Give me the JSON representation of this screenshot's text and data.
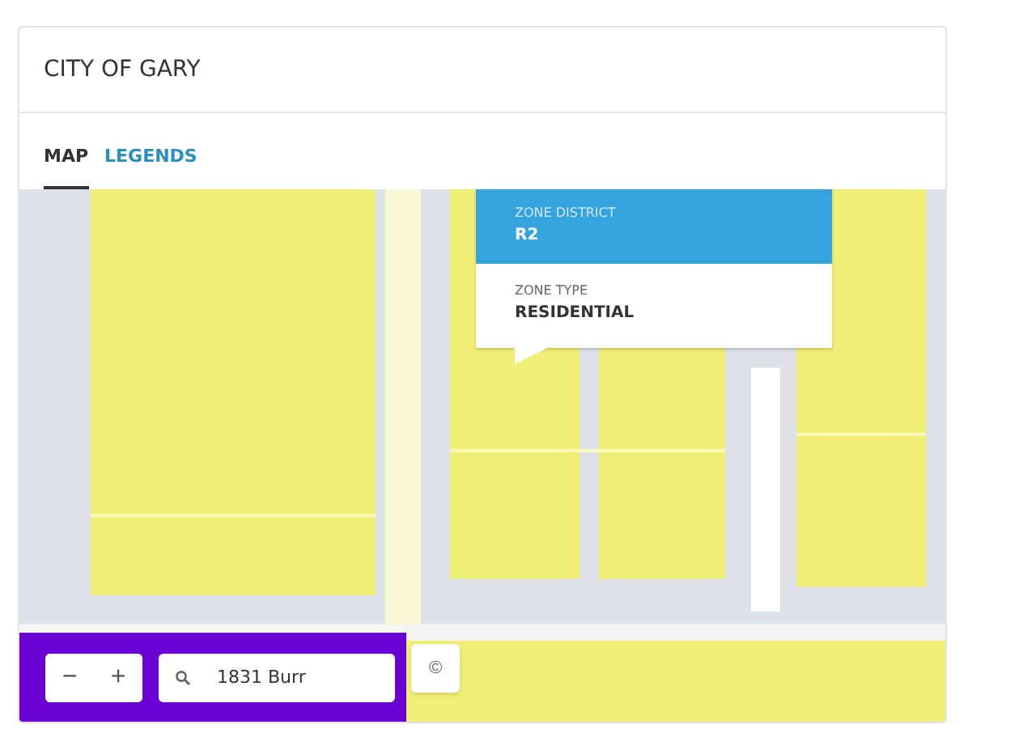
{
  "title": "CITY OF GARY",
  "tabs": [
    {
      "label": "MAP",
      "selected": true
    },
    {
      "label": "LEGENDS",
      "selected": false
    }
  ],
  "popup": {
    "fields": [
      {
        "kind": "highlight",
        "label": "ZONE DISTRICT",
        "value": "R2"
      },
      {
        "kind": "plain",
        "label": "ZONE TYPE",
        "value": "RESIDENTIAL"
      }
    ]
  },
  "zoom_controls": {
    "zoom_out": "−",
    "zoom_in": "+"
  },
  "search": {
    "value": "1831 Burr"
  },
  "attribution": "©"
}
